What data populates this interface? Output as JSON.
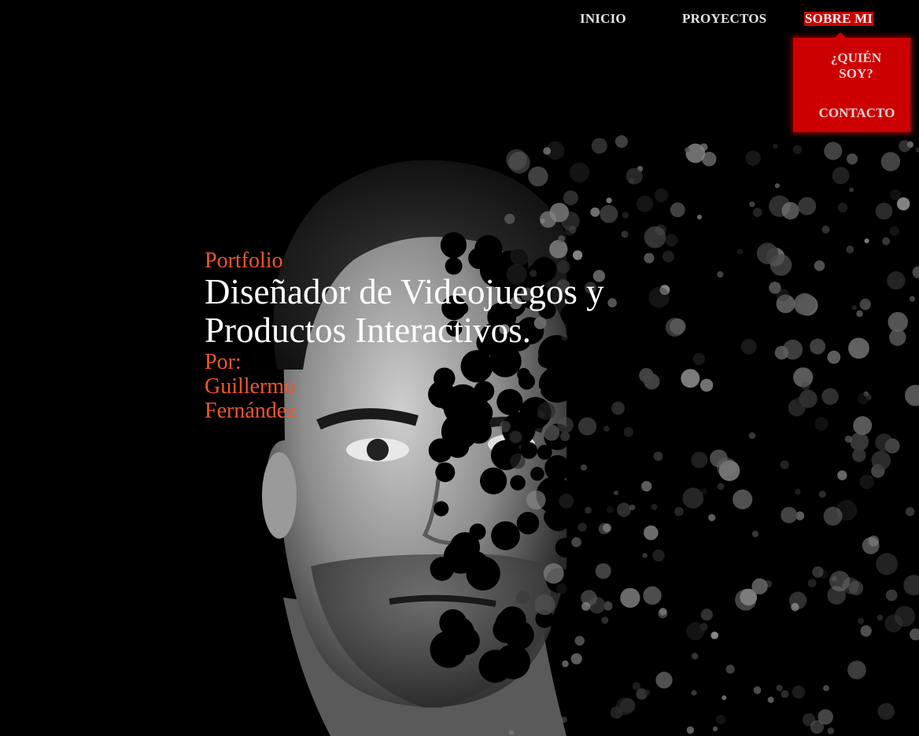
{
  "nav": {
    "items": [
      {
        "label": "INICIO"
      },
      {
        "label": "PROYECTOS"
      },
      {
        "label": "SOBRE MI"
      }
    ],
    "dropdown": {
      "items": [
        {
          "label": "¿QUIÉN SOY?"
        },
        {
          "label": "CONTACTO"
        }
      ]
    }
  },
  "hero": {
    "eyebrow": "Portfolio",
    "headline_line1": "Diseñador de Videojuegos y",
    "headline_line2": "Productos Interactivos.",
    "byline_line1": "Por:",
    "byline_line2": "Guillermo",
    "byline_line3": "Fernández"
  },
  "colors": {
    "background": "#000000",
    "accent": "#cc0000",
    "highlight_text": "#f2552c",
    "nav_text": "#e6e6e6"
  }
}
